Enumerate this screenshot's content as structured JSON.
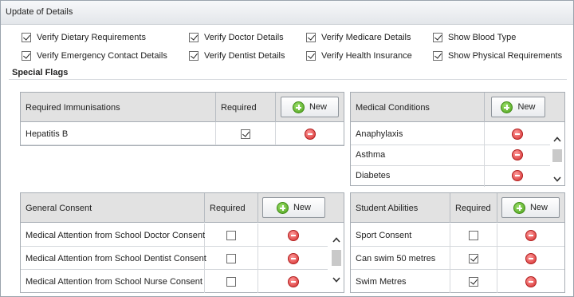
{
  "window": {
    "title": "Update of Details"
  },
  "verify_options": [
    {
      "label": "Verify Dietary Requirements",
      "checked": true
    },
    {
      "label": "Verify Doctor Details",
      "checked": true
    },
    {
      "label": "Verify Medicare Details",
      "checked": true
    },
    {
      "label": "Show Blood Type",
      "checked": true
    },
    {
      "label": "Verify Emergency Contact Details",
      "checked": true
    },
    {
      "label": "Verify Dentist Details",
      "checked": true
    },
    {
      "label": "Verify Health Insurance",
      "checked": true
    },
    {
      "label": "Show Physical Requirements",
      "checked": true
    }
  ],
  "special_flags": {
    "title": "Special Flags"
  },
  "immunisations": {
    "header": "Required Immunisations",
    "required_header": "Required",
    "new_label": "New",
    "rows": [
      {
        "name": "Hepatitis B",
        "required": true
      }
    ]
  },
  "medical_conditions": {
    "header": "Medical Conditions",
    "new_label": "New",
    "rows": [
      {
        "name": "Anaphylaxis"
      },
      {
        "name": "Asthma"
      },
      {
        "name": "Diabetes"
      }
    ]
  },
  "general_consent": {
    "header": "General Consent",
    "required_header": "Required",
    "new_label": "New",
    "rows": [
      {
        "name": "Medical Attention from School Doctor Consent",
        "required": false
      },
      {
        "name": "Medical Attention from School Dentist Consent",
        "required": false
      },
      {
        "name": "Medical Attention from School Nurse Consent",
        "required": false
      }
    ]
  },
  "student_abilities": {
    "header": "Student Abilities",
    "required_header": "Required",
    "new_label": "New",
    "rows": [
      {
        "name": "Sport Consent",
        "required": false
      },
      {
        "name": "Can swim 50 metres",
        "required": true
      },
      {
        "name": "Swim Metres",
        "required": true
      }
    ]
  },
  "icons": {
    "add": "plus-circle-icon",
    "remove": "minus-circle-icon",
    "scroll_up": "chevron-up-icon",
    "scroll_down": "chevron-down-icon"
  },
  "colors": {
    "add_green": "#4c9f1a",
    "remove_red": "#d42c2c",
    "header_gray": "#e2e2e2"
  }
}
